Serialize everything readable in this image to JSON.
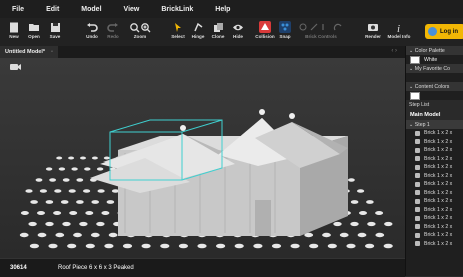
{
  "menu": [
    "File",
    "Edit",
    "Model",
    "View",
    "BrickLink",
    "Help"
  ],
  "toolbar": {
    "new": "New",
    "open": "Open",
    "save": "Save",
    "undo": "Undo",
    "redo": "Redo",
    "zoom": "Zoom",
    "select": "Select",
    "hinge": "Hinge",
    "clone": "Clone",
    "hide": "Hide",
    "collision": "Collision",
    "snap": "Snap",
    "brick_controls": "Brick Controls",
    "render": "Render",
    "model_info": "Model Info",
    "login": "Log in"
  },
  "tab": {
    "title": "Untitled Model*"
  },
  "status": {
    "part_id": "30614",
    "part_name": "Roof Piece 6 x 6 x 3 Peaked"
  },
  "panel": {
    "color_palette": "Color Palette",
    "white": "White",
    "favorite": "My Favorite Co",
    "content_colors": "Content Colors",
    "step_list": "Step List",
    "main_model": "Main Model",
    "step1": "Step 1",
    "bricks": [
      "Brick 1 x 2 x",
      "Brick 1 x 2 x",
      "Brick 1 x 2 x",
      "Brick 1 x 2 x",
      "Brick 1 x 2 x",
      "Brick 1 x 2 x",
      "Brick 1 x 2 x",
      "Brick 1 x 2 x",
      "Brick 1 x 2 x",
      "Brick 1 x 2 x",
      "Brick 1 x 2 x",
      "Brick 1 x 2 x",
      "Brick 1 x 2 x",
      "Brick 1 x 2 x"
    ]
  },
  "colors": {
    "accent": "#f2b705",
    "selection": "#3fd0d0",
    "collision": "#d93a3a",
    "snap": "#3a8fd9"
  }
}
